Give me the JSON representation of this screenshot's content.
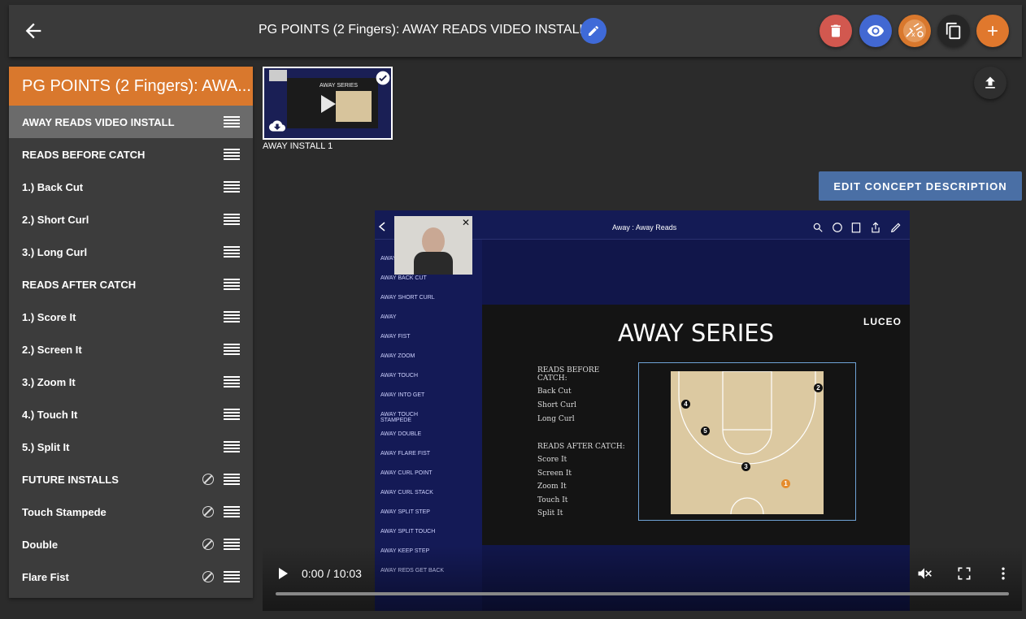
{
  "header": {
    "title": "PG POINTS (2 Fingers): AWAY READS VIDEO INSTALL",
    "actions": [
      {
        "name": "delete",
        "color": "#d2584f",
        "icon": "trash-icon"
      },
      {
        "name": "preview",
        "color": "#4268d2",
        "icon": "eye-icon"
      },
      {
        "name": "playbook",
        "color": "#d9782d",
        "icon": "whistle-icon"
      },
      {
        "name": "copy",
        "color": "#2b2b2b",
        "icon": "copy-icon"
      },
      {
        "name": "add",
        "color": "#e0782d",
        "icon": "plus-icon"
      }
    ]
  },
  "sidebar": {
    "header": "PG POINTS (2 Fingers): AWA...",
    "items": [
      {
        "label": "AWAY READS VIDEO INSTALL",
        "selected": true,
        "blocked": false
      },
      {
        "label": "READS BEFORE CATCH",
        "selected": false,
        "blocked": false
      },
      {
        "label": "1.) Back Cut",
        "selected": false,
        "blocked": false
      },
      {
        "label": "2.) Short Curl",
        "selected": false,
        "blocked": false
      },
      {
        "label": "3.) Long Curl",
        "selected": false,
        "blocked": false
      },
      {
        "label": "READS AFTER CATCH",
        "selected": false,
        "blocked": false
      },
      {
        "label": "1.) Score It",
        "selected": false,
        "blocked": false
      },
      {
        "label": "2.) Screen It",
        "selected": false,
        "blocked": false
      },
      {
        "label": "3.) Zoom It",
        "selected": false,
        "blocked": false
      },
      {
        "label": "4.) Touch It",
        "selected": false,
        "blocked": false
      },
      {
        "label": "5.) Split It",
        "selected": false,
        "blocked": false
      },
      {
        "label": "FUTURE INSTALLS",
        "selected": false,
        "blocked": true
      },
      {
        "label": "Touch Stampede",
        "selected": false,
        "blocked": true
      },
      {
        "label": "Double",
        "selected": false,
        "blocked": true
      },
      {
        "label": "Flare Fist",
        "selected": false,
        "blocked": true
      }
    ]
  },
  "media": {
    "thumb_label": "AWAY INSTALL 1",
    "thumb_slide_title": "AWAY SERIES"
  },
  "edit_description_label": "EDIT CONCEPT DESCRIPTION",
  "video": {
    "app_title": "Away : Away Reads",
    "list": [
      "AWAY READS",
      "AWAY BACK CUT",
      "AWAY SHORT CURL",
      "AWAY",
      "AWAY FIST",
      "AWAY ZOOM",
      "AWAY TOUCH",
      "AWAY INTO GET",
      "AWAY TOUCH STAMPEDE",
      "AWAY DOUBLE",
      "AWAY FLARE FIST",
      "AWAY CURL POINT",
      "AWAY CURL STACK",
      "AWAY SPLIT STEP",
      "AWAY SPLIT TOUCH",
      "AWAY KEEP STEP",
      "AWAY REDS GET BACK"
    ],
    "slide_title": "AWAY SERIES",
    "brand": "LUCEO",
    "reads_before_title": "READS BEFORE CATCH:",
    "reads_before": [
      "Back Cut",
      "Short Curl",
      "Long Curl"
    ],
    "reads_after_title": "READS AFTER CATCH:",
    "reads_after": [
      "Score It",
      "Screen It",
      "Zoom It",
      "Touch It",
      "Split It"
    ],
    "player_numbers": [
      "4",
      "2",
      "5",
      "3",
      "1"
    ],
    "time": "0:00 / 10:03"
  }
}
